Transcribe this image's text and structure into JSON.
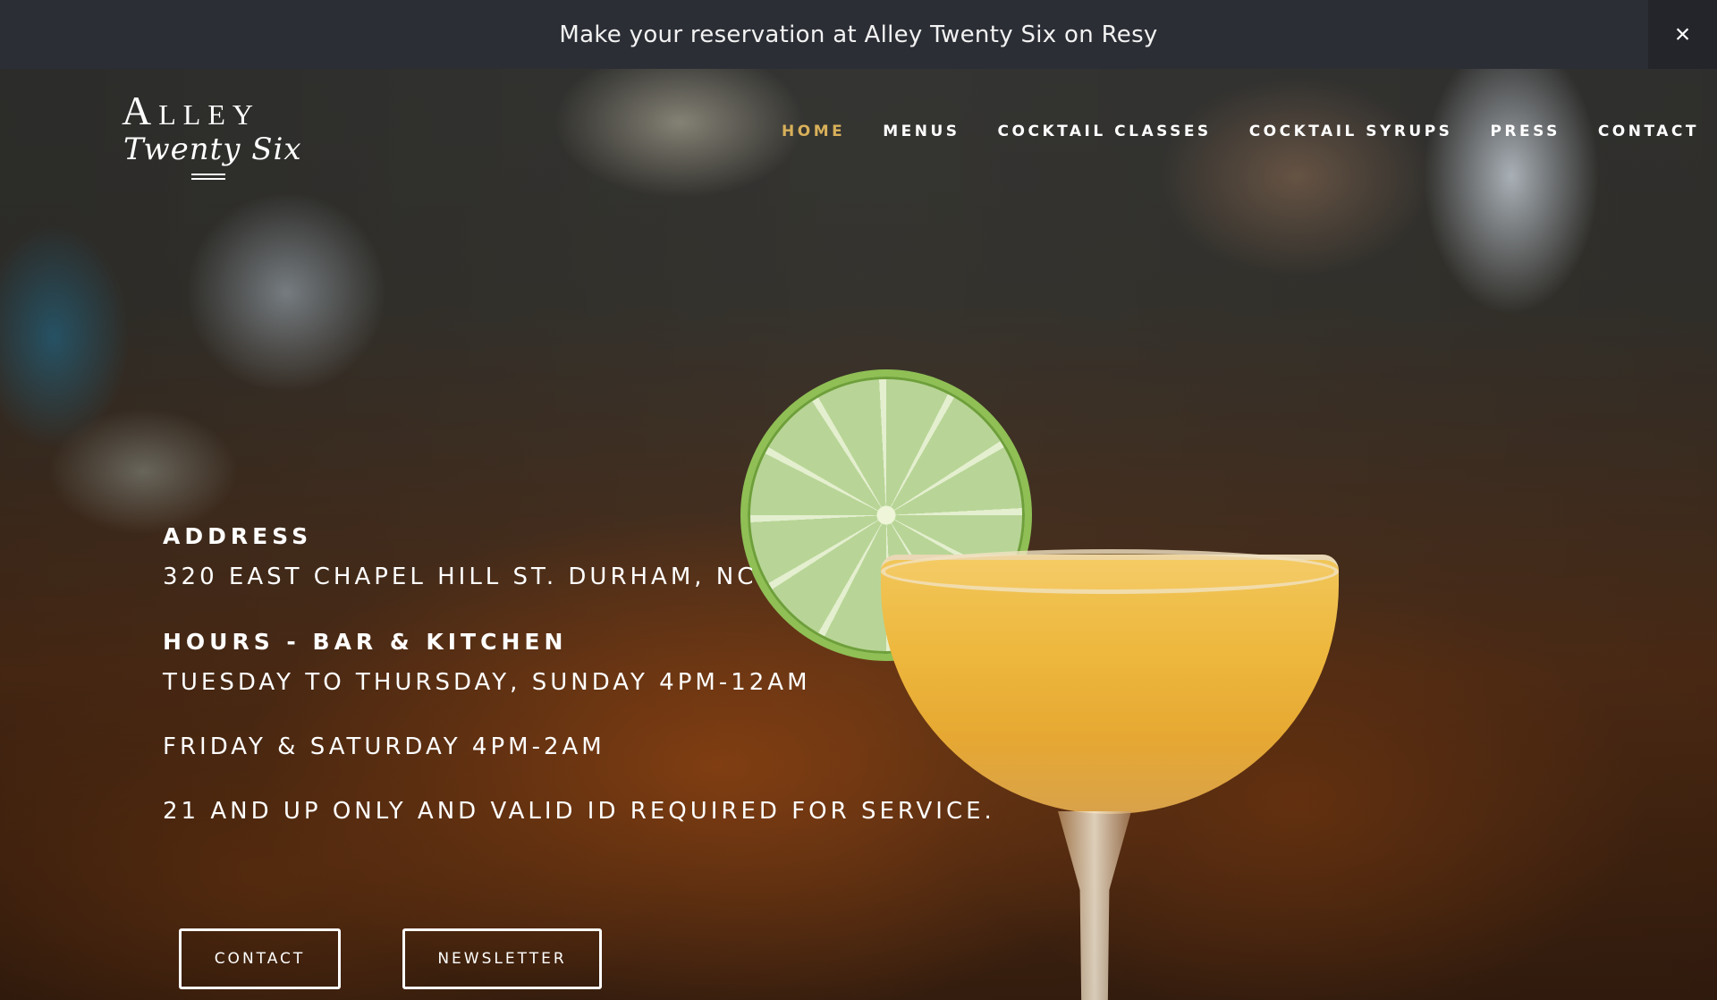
{
  "banner": {
    "text": "Make your reservation at Alley Twenty Six on Resy",
    "close_icon": "×"
  },
  "logo": {
    "line1": "Alley",
    "line2": "Twenty Six"
  },
  "nav": {
    "items": [
      {
        "label": "HOME",
        "active": true
      },
      {
        "label": "MENUS",
        "active": false
      },
      {
        "label": "COCKTAIL CLASSES",
        "active": false
      },
      {
        "label": "COCKTAIL SYRUPS",
        "active": false
      },
      {
        "label": "PRESS",
        "active": false
      },
      {
        "label": "CONTACT",
        "active": false
      }
    ],
    "active_color": "#d8b05a"
  },
  "info": {
    "address_heading": "ADDRESS",
    "address": "320 EAST CHAPEL HILL ST. DURHAM, NC",
    "hours_heading": "HOURS - BAR & KITCHEN",
    "hours_1": "TUESDAY TO THURSDAY, SUNDAY 4PM-12AM",
    "hours_2": "FRIDAY & SATURDAY 4PM-2AM",
    "notice": "21 AND UP ONLY AND VALID ID REQUIRED FOR SERVICE."
  },
  "buttons": {
    "contact": "CONTACT",
    "newsletter": "NEWSLETTER"
  }
}
